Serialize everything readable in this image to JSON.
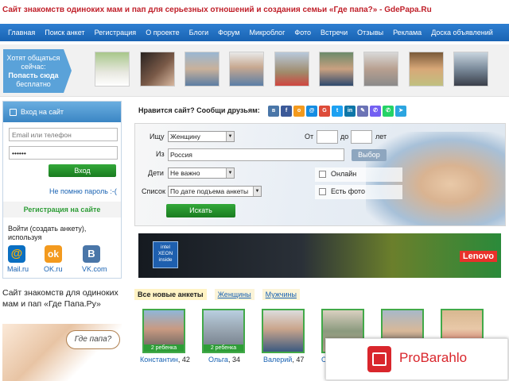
{
  "header": {
    "title": "Сайт знакомств одиноких мам и пап для серьезных отношений и создания семьи «Где папа?» - GdePapa.Ru"
  },
  "nav": [
    "Главная",
    "Поиск анкет",
    "Регистрация",
    "О проекте",
    "Блоги",
    "Форум",
    "Микроблог",
    "Фото",
    "Встречи",
    "Отзывы",
    "Реклама",
    "Доска объявлений"
  ],
  "online": {
    "line1": "Хотят общаться",
    "line2": "сейчас:",
    "line3": "Попасть сюда",
    "line4": "бесплатно"
  },
  "login": {
    "title": "Вход на сайт",
    "email_placeholder": "Email или телефон",
    "password_value": "••••••",
    "submit_label": "Вход",
    "forgot_label": "Не помню пароль :-(",
    "register_label": "Регистрация на сайте",
    "social_prompt": "Войти (создать анкету), используя",
    "social": [
      "Mail.ru",
      "OK.ru",
      "VK.com"
    ]
  },
  "slogan": "Сайт знакомств для одиноких мам и пап «Где Папа.Ру»",
  "slogan_bubble": "Где папа?",
  "share": {
    "label": "Нравится сайт? Сообщи друзьям:"
  },
  "search": {
    "seek_label": "Ищу",
    "seek_value": "Женщину",
    "from_label": "От",
    "to_label": "до",
    "years_label": "лет",
    "where_label": "Из",
    "where_value": "Россия",
    "choose_label": "Выбор",
    "kids_label": "Дети",
    "kids_value": "Не важно",
    "online_label": "Онлайн",
    "list_label": "Список",
    "list_value": "По дате подъема анкеты",
    "photo_label": "Есть фото",
    "submit_label": "Искать"
  },
  "banner": {
    "intel": "intel XEON inside",
    "brand": "Lenovo"
  },
  "tabs": [
    "Все новые анкеты",
    "Женщины",
    "Мужчины"
  ],
  "profiles": [
    {
      "name": "Константин",
      "age": ", 42",
      "badge": "2 ребенка"
    },
    {
      "name": "Ольга",
      "age": ", 34",
      "badge": "2 ребенка"
    },
    {
      "name": "Валерий",
      "age": ", 47",
      "badge": ""
    },
    {
      "name": "С",
      "age": "",
      "badge": ""
    }
  ],
  "ad": {
    "text": "ProBarahlo"
  },
  "colors": {
    "title_red": "#c0202a",
    "nav_blue": "#1963b3",
    "green": "#2e9d37",
    "ad_red": "#d9262c"
  }
}
